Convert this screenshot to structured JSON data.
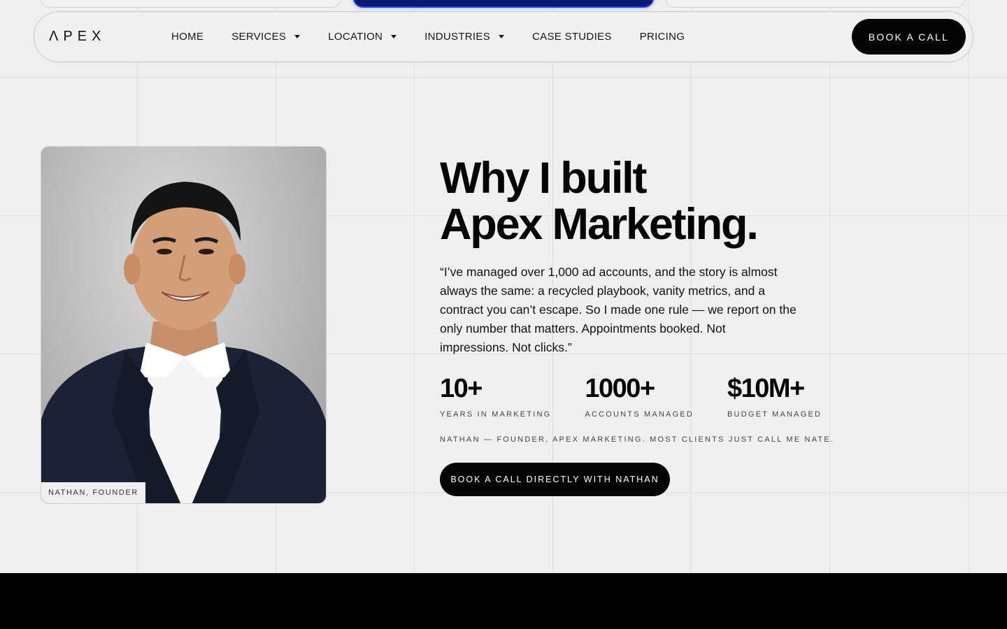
{
  "brand": {
    "logo_text": "ΛPEX"
  },
  "nav": {
    "items": [
      {
        "label": "HOME",
        "has_dropdown": false
      },
      {
        "label": "SERVICES",
        "has_dropdown": true
      },
      {
        "label": "LOCATION",
        "has_dropdown": true
      },
      {
        "label": "INDUSTRIES",
        "has_dropdown": true
      },
      {
        "label": "CASE STUDIES",
        "has_dropdown": false
      },
      {
        "label": "PRICING",
        "has_dropdown": false
      }
    ],
    "cta_label": "BOOK A CALL"
  },
  "founder": {
    "photo_caption": "NATHAN, FOUNDER",
    "headline_line1": "Why I built",
    "headline_line2": "Apex Marketing.",
    "quote": "“I’ve managed over 1,000 ad accounts, and the story is almost always the same: a recycled playbook, vanity metrics, and a contract you can’t escape. So I made one rule — we report on the only number that matters. Appointments booked. Not impressions. Not clicks.”",
    "stats": [
      {
        "value": "10+",
        "label": "YEARS IN MARKETING"
      },
      {
        "value": "1000+",
        "label": "ACCOUNTS MANAGED"
      },
      {
        "value": "$10M+",
        "label": "BUDGET MANAGED"
      }
    ],
    "byline": "NATHAN — FOUNDER, APEX MARKETING. MOST CLIENTS JUST CALL ME NATE.",
    "cta_label": "BOOK A CALL DIRECTLY WITH NATHAN"
  },
  "colors": {
    "accent": "#050505",
    "background": "#efefef",
    "peek_card_accent": "#1c3fd6"
  }
}
